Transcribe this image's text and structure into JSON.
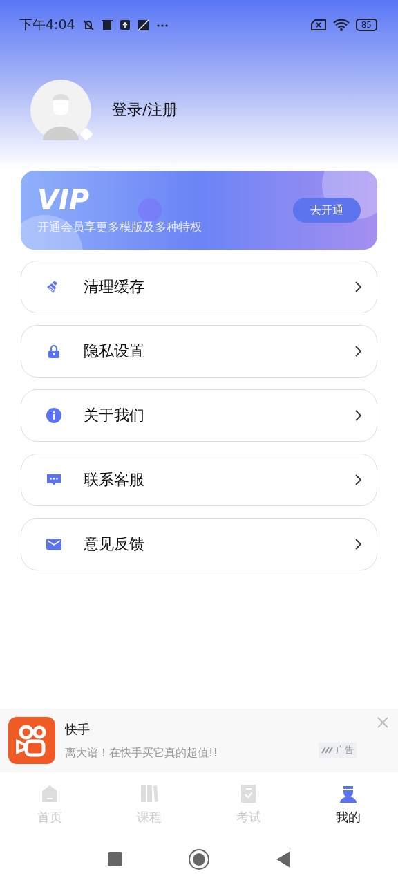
{
  "status_bar": {
    "time": "下午4:04",
    "battery": "85"
  },
  "profile": {
    "login": "登录/注册"
  },
  "vip": {
    "title": "VIP",
    "subtitle": "开通会员享更多模版及多种特权",
    "button": "去开通"
  },
  "menu": [
    {
      "kind": "clean",
      "label": "清理缓存"
    },
    {
      "kind": "privacy",
      "label": "隐私设置"
    },
    {
      "kind": "about",
      "label": "关于我们"
    },
    {
      "kind": "service",
      "label": "联系客服"
    },
    {
      "kind": "feedback",
      "label": "意见反馈"
    }
  ],
  "ad": {
    "title": "快手",
    "text": "离大谱！在快手买它真的超值!!",
    "badge": "广告"
  },
  "tabs": [
    {
      "kind": "home",
      "label": "首页",
      "selected": false
    },
    {
      "kind": "course",
      "label": "课程",
      "selected": false
    },
    {
      "kind": "exam",
      "label": "考试",
      "selected": false
    },
    {
      "kind": "mine",
      "label": "我的",
      "selected": true
    }
  ]
}
